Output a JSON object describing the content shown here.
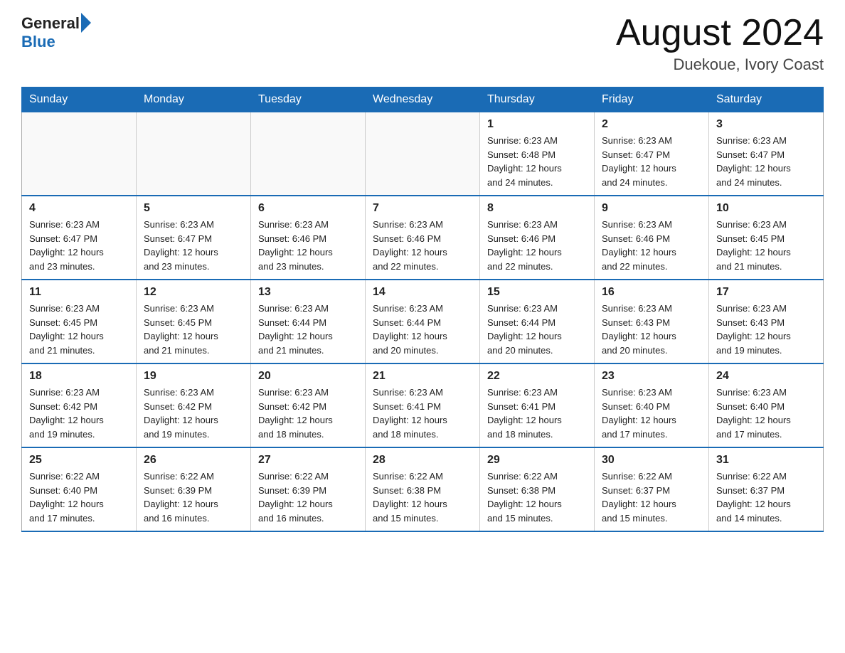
{
  "header": {
    "logo_general": "General",
    "logo_blue": "Blue",
    "month_title": "August 2024",
    "location": "Duekoue, Ivory Coast"
  },
  "days_of_week": [
    "Sunday",
    "Monday",
    "Tuesday",
    "Wednesday",
    "Thursday",
    "Friday",
    "Saturday"
  ],
  "weeks": [
    [
      {
        "day": "",
        "info": ""
      },
      {
        "day": "",
        "info": ""
      },
      {
        "day": "",
        "info": ""
      },
      {
        "day": "",
        "info": ""
      },
      {
        "day": "1",
        "info": "Sunrise: 6:23 AM\nSunset: 6:48 PM\nDaylight: 12 hours\nand 24 minutes."
      },
      {
        "day": "2",
        "info": "Sunrise: 6:23 AM\nSunset: 6:47 PM\nDaylight: 12 hours\nand 24 minutes."
      },
      {
        "day": "3",
        "info": "Sunrise: 6:23 AM\nSunset: 6:47 PM\nDaylight: 12 hours\nand 24 minutes."
      }
    ],
    [
      {
        "day": "4",
        "info": "Sunrise: 6:23 AM\nSunset: 6:47 PM\nDaylight: 12 hours\nand 23 minutes."
      },
      {
        "day": "5",
        "info": "Sunrise: 6:23 AM\nSunset: 6:47 PM\nDaylight: 12 hours\nand 23 minutes."
      },
      {
        "day": "6",
        "info": "Sunrise: 6:23 AM\nSunset: 6:46 PM\nDaylight: 12 hours\nand 23 minutes."
      },
      {
        "day": "7",
        "info": "Sunrise: 6:23 AM\nSunset: 6:46 PM\nDaylight: 12 hours\nand 22 minutes."
      },
      {
        "day": "8",
        "info": "Sunrise: 6:23 AM\nSunset: 6:46 PM\nDaylight: 12 hours\nand 22 minutes."
      },
      {
        "day": "9",
        "info": "Sunrise: 6:23 AM\nSunset: 6:46 PM\nDaylight: 12 hours\nand 22 minutes."
      },
      {
        "day": "10",
        "info": "Sunrise: 6:23 AM\nSunset: 6:45 PM\nDaylight: 12 hours\nand 21 minutes."
      }
    ],
    [
      {
        "day": "11",
        "info": "Sunrise: 6:23 AM\nSunset: 6:45 PM\nDaylight: 12 hours\nand 21 minutes."
      },
      {
        "day": "12",
        "info": "Sunrise: 6:23 AM\nSunset: 6:45 PM\nDaylight: 12 hours\nand 21 minutes."
      },
      {
        "day": "13",
        "info": "Sunrise: 6:23 AM\nSunset: 6:44 PM\nDaylight: 12 hours\nand 21 minutes."
      },
      {
        "day": "14",
        "info": "Sunrise: 6:23 AM\nSunset: 6:44 PM\nDaylight: 12 hours\nand 20 minutes."
      },
      {
        "day": "15",
        "info": "Sunrise: 6:23 AM\nSunset: 6:44 PM\nDaylight: 12 hours\nand 20 minutes."
      },
      {
        "day": "16",
        "info": "Sunrise: 6:23 AM\nSunset: 6:43 PM\nDaylight: 12 hours\nand 20 minutes."
      },
      {
        "day": "17",
        "info": "Sunrise: 6:23 AM\nSunset: 6:43 PM\nDaylight: 12 hours\nand 19 minutes."
      }
    ],
    [
      {
        "day": "18",
        "info": "Sunrise: 6:23 AM\nSunset: 6:42 PM\nDaylight: 12 hours\nand 19 minutes."
      },
      {
        "day": "19",
        "info": "Sunrise: 6:23 AM\nSunset: 6:42 PM\nDaylight: 12 hours\nand 19 minutes."
      },
      {
        "day": "20",
        "info": "Sunrise: 6:23 AM\nSunset: 6:42 PM\nDaylight: 12 hours\nand 18 minutes."
      },
      {
        "day": "21",
        "info": "Sunrise: 6:23 AM\nSunset: 6:41 PM\nDaylight: 12 hours\nand 18 minutes."
      },
      {
        "day": "22",
        "info": "Sunrise: 6:23 AM\nSunset: 6:41 PM\nDaylight: 12 hours\nand 18 minutes."
      },
      {
        "day": "23",
        "info": "Sunrise: 6:23 AM\nSunset: 6:40 PM\nDaylight: 12 hours\nand 17 minutes."
      },
      {
        "day": "24",
        "info": "Sunrise: 6:23 AM\nSunset: 6:40 PM\nDaylight: 12 hours\nand 17 minutes."
      }
    ],
    [
      {
        "day": "25",
        "info": "Sunrise: 6:22 AM\nSunset: 6:40 PM\nDaylight: 12 hours\nand 17 minutes."
      },
      {
        "day": "26",
        "info": "Sunrise: 6:22 AM\nSunset: 6:39 PM\nDaylight: 12 hours\nand 16 minutes."
      },
      {
        "day": "27",
        "info": "Sunrise: 6:22 AM\nSunset: 6:39 PM\nDaylight: 12 hours\nand 16 minutes."
      },
      {
        "day": "28",
        "info": "Sunrise: 6:22 AM\nSunset: 6:38 PM\nDaylight: 12 hours\nand 15 minutes."
      },
      {
        "day": "29",
        "info": "Sunrise: 6:22 AM\nSunset: 6:38 PM\nDaylight: 12 hours\nand 15 minutes."
      },
      {
        "day": "30",
        "info": "Sunrise: 6:22 AM\nSunset: 6:37 PM\nDaylight: 12 hours\nand 15 minutes."
      },
      {
        "day": "31",
        "info": "Sunrise: 6:22 AM\nSunset: 6:37 PM\nDaylight: 12 hours\nand 14 minutes."
      }
    ]
  ]
}
